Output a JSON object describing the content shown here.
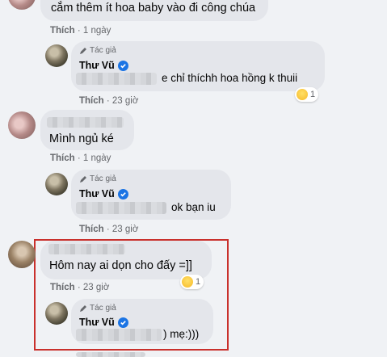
{
  "comments": [
    {
      "text": "cắm thêm ít hoa baby vào đi công chúa",
      "action": "Thích",
      "time": "1 ngày"
    },
    {
      "author_tag": "Tác giả",
      "author": "Thư Vũ",
      "text": "e chỉ thíchh hoa hồng k thuii",
      "action": "Thích",
      "time": "23 giờ",
      "reaction_count": "1"
    },
    {
      "text": "Mình ngủ ké",
      "action": "Thích",
      "time": "1 ngày"
    },
    {
      "author_tag": "Tác giả",
      "author": "Thư Vũ",
      "text": "ok bạn iu",
      "action": "Thích",
      "time": "23 giờ"
    },
    {
      "text": "Hôm nay ai dọn cho đấy =]]",
      "action": "Thích",
      "time": "23 giờ",
      "reaction_count": "1"
    },
    {
      "author_tag": "Tác giả",
      "author": "Thư Vũ",
      "text": ") mẹ:)))"
    }
  ],
  "colors": {
    "background": "#f0f2f5",
    "bubble": "#e4e6eb",
    "verified": "#1b74e4",
    "highlight_box": "#c9302c",
    "meta_text": "#65676b"
  },
  "icons": [
    "pen-icon",
    "verified-badge-icon",
    "haha-reaction-icon"
  ]
}
